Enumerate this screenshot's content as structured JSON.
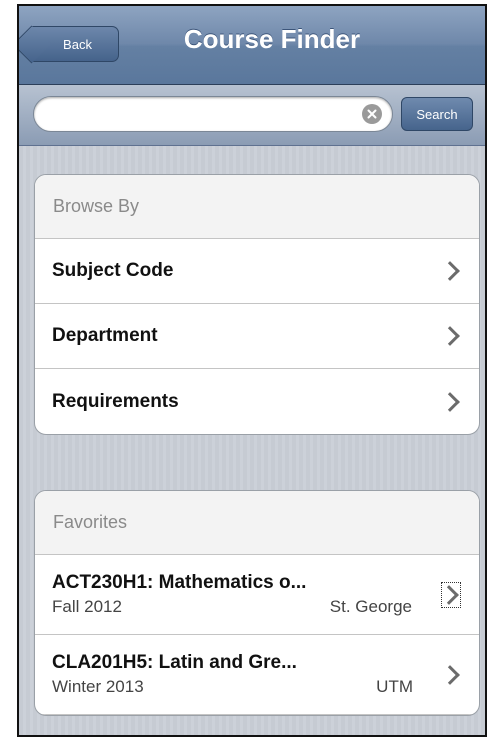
{
  "navbar": {
    "back_label": "Back",
    "title": "Course Finder"
  },
  "search": {
    "value": "",
    "placeholder": "",
    "button_label": "Search"
  },
  "browse": {
    "header": "Browse By",
    "items": [
      {
        "label": "Subject Code"
      },
      {
        "label": "Department"
      },
      {
        "label": "Requirements"
      }
    ]
  },
  "favorites": {
    "header": "Favorites",
    "items": [
      {
        "title": "ACT230H1: Mathematics o...",
        "term": "Fall 2012",
        "campus": "St. George"
      },
      {
        "title": "CLA201H5: Latin and Gre...",
        "term": "Winter 2013",
        "campus": "UTM"
      }
    ]
  },
  "colors": {
    "nav_bar": "#6f88aa",
    "group_header_text": "#8a8a8a"
  }
}
